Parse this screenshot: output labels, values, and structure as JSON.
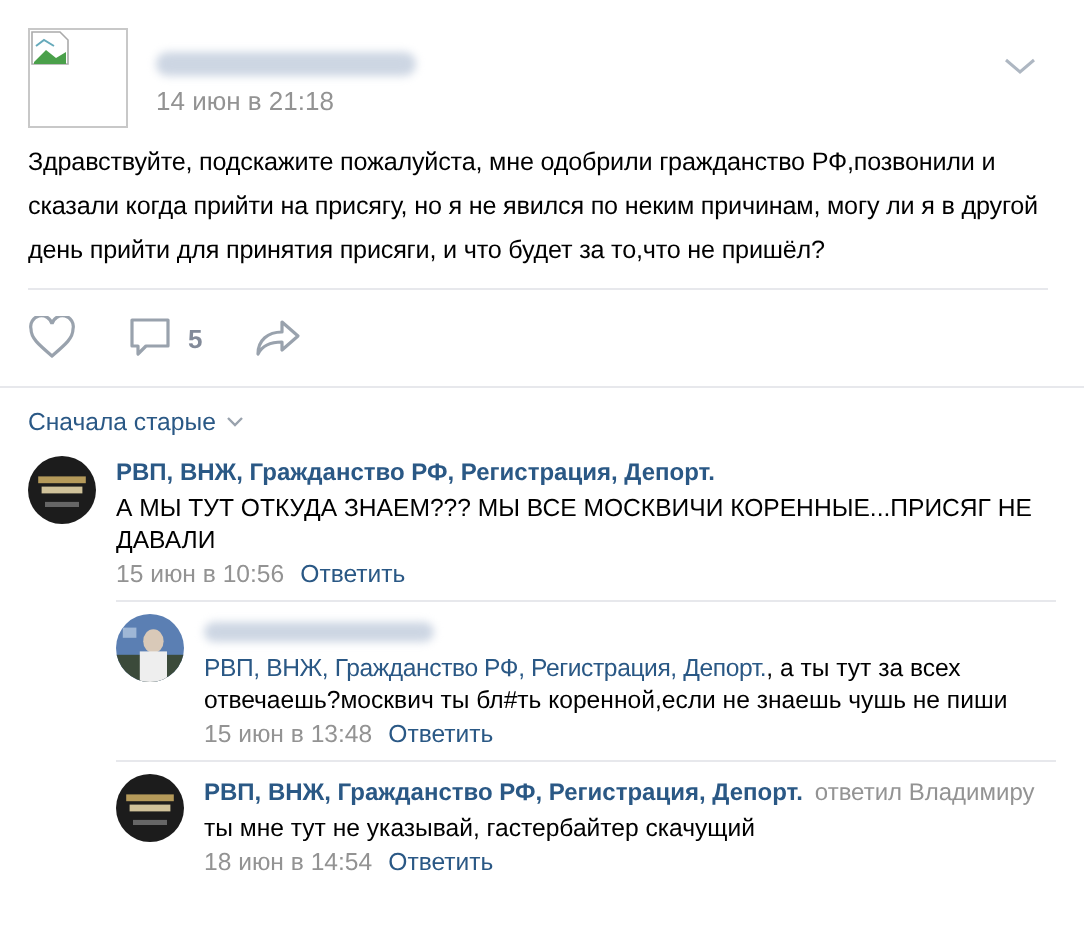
{
  "post": {
    "author_hidden": true,
    "date": "14 июн в 21:18",
    "text": "Здравствуйте, подскажите пожалуйста, мне одобрили гражданство РФ,позвонили и сказали когда прийти на присягу, но я не явился по неким причинам, могу ли я в другой день прийти для принятия присяги, и что будет за то,что не пришёл?",
    "comments_count": "5"
  },
  "sort": "Сначала старые",
  "comments": [
    {
      "author": "РВП, ВНЖ, Гражданство РФ, Регистрация, Депорт.",
      "text": "А МЫ ТУТ ОТКУДА ЗНАЕМ??? МЫ ВСЕ МОСКВИЧИ КОРЕННЫЕ...ПРИСЯГ НЕ ДАВАЛИ",
      "date": "15 июн в 10:56",
      "reply_label": "Ответить",
      "children": [
        {
          "author_hidden": true,
          "reply_to": "РВП, ВНЖ, Гражданство РФ, Регистрация, Депорт.",
          "text": ", а ты тут за всех отвечаешь?москвич ты бл#ть коренной,если не знаешь чушь не пиши",
          "date": "15 июн в 13:48",
          "reply_label": "Ответить"
        },
        {
          "author": "РВП, ВНЖ, Гражданство РФ, Регистрация, Депорт.",
          "reply_note": "ответил Владимиру",
          "text": "ты мне тут не указывай, гастербайтер скачущий",
          "date": "18 июн в 14:54",
          "reply_label": "Ответить"
        }
      ]
    }
  ]
}
